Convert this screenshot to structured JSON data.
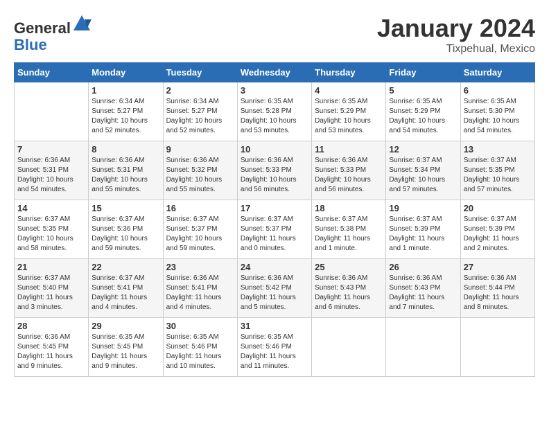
{
  "header": {
    "logo_general": "General",
    "logo_blue": "Blue",
    "month": "January 2024",
    "location": "Tixpehual, Mexico"
  },
  "days_of_week": [
    "Sunday",
    "Monday",
    "Tuesday",
    "Wednesday",
    "Thursday",
    "Friday",
    "Saturday"
  ],
  "weeks": [
    [
      {
        "day": "",
        "sunrise": "",
        "sunset": "",
        "daylight": ""
      },
      {
        "day": "1",
        "sunrise": "Sunrise: 6:34 AM",
        "sunset": "Sunset: 5:27 PM",
        "daylight": "Daylight: 10 hours and 52 minutes."
      },
      {
        "day": "2",
        "sunrise": "Sunrise: 6:34 AM",
        "sunset": "Sunset: 5:27 PM",
        "daylight": "Daylight: 10 hours and 52 minutes."
      },
      {
        "day": "3",
        "sunrise": "Sunrise: 6:35 AM",
        "sunset": "Sunset: 5:28 PM",
        "daylight": "Daylight: 10 hours and 53 minutes."
      },
      {
        "day": "4",
        "sunrise": "Sunrise: 6:35 AM",
        "sunset": "Sunset: 5:29 PM",
        "daylight": "Daylight: 10 hours and 53 minutes."
      },
      {
        "day": "5",
        "sunrise": "Sunrise: 6:35 AM",
        "sunset": "Sunset: 5:29 PM",
        "daylight": "Daylight: 10 hours and 54 minutes."
      },
      {
        "day": "6",
        "sunrise": "Sunrise: 6:35 AM",
        "sunset": "Sunset: 5:30 PM",
        "daylight": "Daylight: 10 hours and 54 minutes."
      }
    ],
    [
      {
        "day": "7",
        "sunrise": "Sunrise: 6:36 AM",
        "sunset": "Sunset: 5:31 PM",
        "daylight": "Daylight: 10 hours and 54 minutes."
      },
      {
        "day": "8",
        "sunrise": "Sunrise: 6:36 AM",
        "sunset": "Sunset: 5:31 PM",
        "daylight": "Daylight: 10 hours and 55 minutes."
      },
      {
        "day": "9",
        "sunrise": "Sunrise: 6:36 AM",
        "sunset": "Sunset: 5:32 PM",
        "daylight": "Daylight: 10 hours and 55 minutes."
      },
      {
        "day": "10",
        "sunrise": "Sunrise: 6:36 AM",
        "sunset": "Sunset: 5:33 PM",
        "daylight": "Daylight: 10 hours and 56 minutes."
      },
      {
        "day": "11",
        "sunrise": "Sunrise: 6:36 AM",
        "sunset": "Sunset: 5:33 PM",
        "daylight": "Daylight: 10 hours and 56 minutes."
      },
      {
        "day": "12",
        "sunrise": "Sunrise: 6:37 AM",
        "sunset": "Sunset: 5:34 PM",
        "daylight": "Daylight: 10 hours and 57 minutes."
      },
      {
        "day": "13",
        "sunrise": "Sunrise: 6:37 AM",
        "sunset": "Sunset: 5:35 PM",
        "daylight": "Daylight: 10 hours and 57 minutes."
      }
    ],
    [
      {
        "day": "14",
        "sunrise": "Sunrise: 6:37 AM",
        "sunset": "Sunset: 5:35 PM",
        "daylight": "Daylight: 10 hours and 58 minutes."
      },
      {
        "day": "15",
        "sunrise": "Sunrise: 6:37 AM",
        "sunset": "Sunset: 5:36 PM",
        "daylight": "Daylight: 10 hours and 59 minutes."
      },
      {
        "day": "16",
        "sunrise": "Sunrise: 6:37 AM",
        "sunset": "Sunset: 5:37 PM",
        "daylight": "Daylight: 10 hours and 59 minutes."
      },
      {
        "day": "17",
        "sunrise": "Sunrise: 6:37 AM",
        "sunset": "Sunset: 5:37 PM",
        "daylight": "Daylight: 11 hours and 0 minutes."
      },
      {
        "day": "18",
        "sunrise": "Sunrise: 6:37 AM",
        "sunset": "Sunset: 5:38 PM",
        "daylight": "Daylight: 11 hours and 1 minute."
      },
      {
        "day": "19",
        "sunrise": "Sunrise: 6:37 AM",
        "sunset": "Sunset: 5:39 PM",
        "daylight": "Daylight: 11 hours and 1 minute."
      },
      {
        "day": "20",
        "sunrise": "Sunrise: 6:37 AM",
        "sunset": "Sunset: 5:39 PM",
        "daylight": "Daylight: 11 hours and 2 minutes."
      }
    ],
    [
      {
        "day": "21",
        "sunrise": "Sunrise: 6:37 AM",
        "sunset": "Sunset: 5:40 PM",
        "daylight": "Daylight: 11 hours and 3 minutes."
      },
      {
        "day": "22",
        "sunrise": "Sunrise: 6:37 AM",
        "sunset": "Sunset: 5:41 PM",
        "daylight": "Daylight: 11 hours and 4 minutes."
      },
      {
        "day": "23",
        "sunrise": "Sunrise: 6:36 AM",
        "sunset": "Sunset: 5:41 PM",
        "daylight": "Daylight: 11 hours and 4 minutes."
      },
      {
        "day": "24",
        "sunrise": "Sunrise: 6:36 AM",
        "sunset": "Sunset: 5:42 PM",
        "daylight": "Daylight: 11 hours and 5 minutes."
      },
      {
        "day": "25",
        "sunrise": "Sunrise: 6:36 AM",
        "sunset": "Sunset: 5:43 PM",
        "daylight": "Daylight: 11 hours and 6 minutes."
      },
      {
        "day": "26",
        "sunrise": "Sunrise: 6:36 AM",
        "sunset": "Sunset: 5:43 PM",
        "daylight": "Daylight: 11 hours and 7 minutes."
      },
      {
        "day": "27",
        "sunrise": "Sunrise: 6:36 AM",
        "sunset": "Sunset: 5:44 PM",
        "daylight": "Daylight: 11 hours and 8 minutes."
      }
    ],
    [
      {
        "day": "28",
        "sunrise": "Sunrise: 6:36 AM",
        "sunset": "Sunset: 5:45 PM",
        "daylight": "Daylight: 11 hours and 9 minutes."
      },
      {
        "day": "29",
        "sunrise": "Sunrise: 6:35 AM",
        "sunset": "Sunset: 5:45 PM",
        "daylight": "Daylight: 11 hours and 9 minutes."
      },
      {
        "day": "30",
        "sunrise": "Sunrise: 6:35 AM",
        "sunset": "Sunset: 5:46 PM",
        "daylight": "Daylight: 11 hours and 10 minutes."
      },
      {
        "day": "31",
        "sunrise": "Sunrise: 6:35 AM",
        "sunset": "Sunset: 5:46 PM",
        "daylight": "Daylight: 11 hours and 11 minutes."
      },
      {
        "day": "",
        "sunrise": "",
        "sunset": "",
        "daylight": ""
      },
      {
        "day": "",
        "sunrise": "",
        "sunset": "",
        "daylight": ""
      },
      {
        "day": "",
        "sunrise": "",
        "sunset": "",
        "daylight": ""
      }
    ]
  ]
}
